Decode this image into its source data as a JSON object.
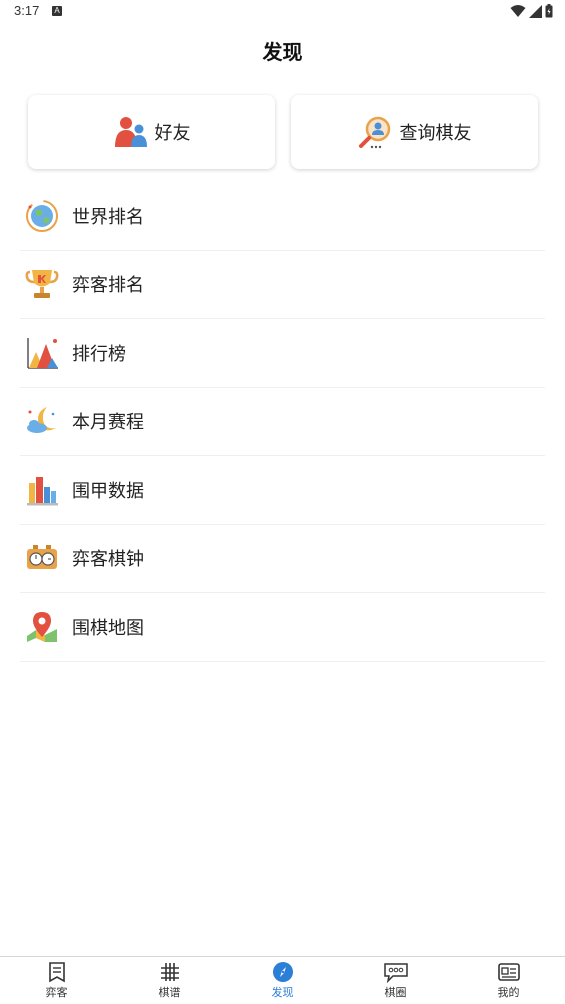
{
  "status_bar": {
    "time": "3:17",
    "notification_icon": "A"
  },
  "header": {
    "title": "发现"
  },
  "cards": [
    {
      "label": "好友",
      "icon": "friends-icon"
    },
    {
      "label": "查询棋友",
      "icon": "search-player-icon"
    }
  ],
  "menu": [
    {
      "label": "世界排名",
      "icon": "globe-icon"
    },
    {
      "label": "弈客排名",
      "icon": "trophy-icon"
    },
    {
      "label": "排行榜",
      "icon": "mountain-chart-icon"
    },
    {
      "label": "本月赛程",
      "icon": "moon-cloud-icon"
    },
    {
      "label": "围甲数据",
      "icon": "bar-chart-icon"
    },
    {
      "label": "弈客棋钟",
      "icon": "chess-clock-icon"
    },
    {
      "label": "围棋地图",
      "icon": "map-pin-icon"
    }
  ],
  "bottom_nav": [
    {
      "label": "弈客",
      "icon": "bookmark-icon"
    },
    {
      "label": "棋谱",
      "icon": "grid-icon"
    },
    {
      "label": "发现",
      "icon": "compass-icon",
      "active": true
    },
    {
      "label": "棋圈",
      "icon": "chat-icon"
    },
    {
      "label": "我的",
      "icon": "profile-card-icon"
    }
  ],
  "colors": {
    "active": "#2b7fd6",
    "inactive": "#333333"
  }
}
